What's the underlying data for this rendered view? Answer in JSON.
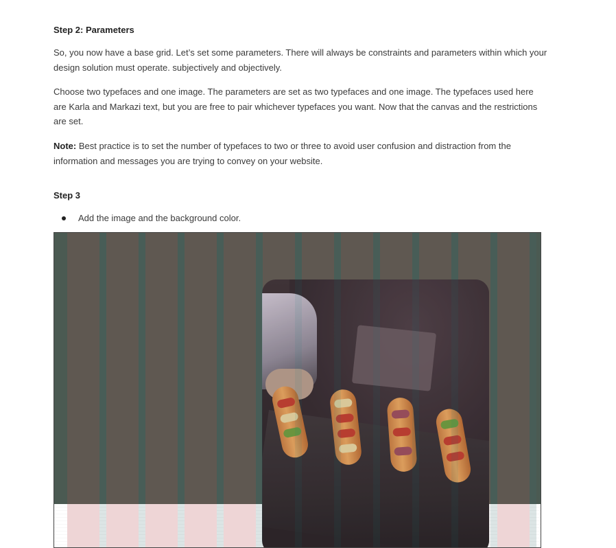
{
  "step2": {
    "heading": "Step 2:  Parameters",
    "para1": "So, you now have a base grid. Let’s set some parameters. There will always be constraints and parameters within which your design solution must operate. subjectively and objectively.",
    "para2": "Choose two typefaces and one image. The parameters are set as two typefaces and one image. The typefaces used here are Karla and Markazi text, but you are free to pair whichever typefaces you want. Now that the canvas and the restrictions are set.",
    "note_label": "Note:",
    "note_text": " Best practice is to set the number of typefaces to two or three to avoid user confusion and distraction from the information and messages you are trying to convey on your website."
  },
  "step3": {
    "heading": "Step 3",
    "bullets": [
      "Add the image and the background color."
    ]
  },
  "illustration": {
    "background_color": "#4b5a52",
    "column_color": "#5e5750",
    "gutter_color": "#4b5a52",
    "bottom_column_color": "#fde3e4",
    "image_subject": "eclairs-on-slate-photo"
  }
}
